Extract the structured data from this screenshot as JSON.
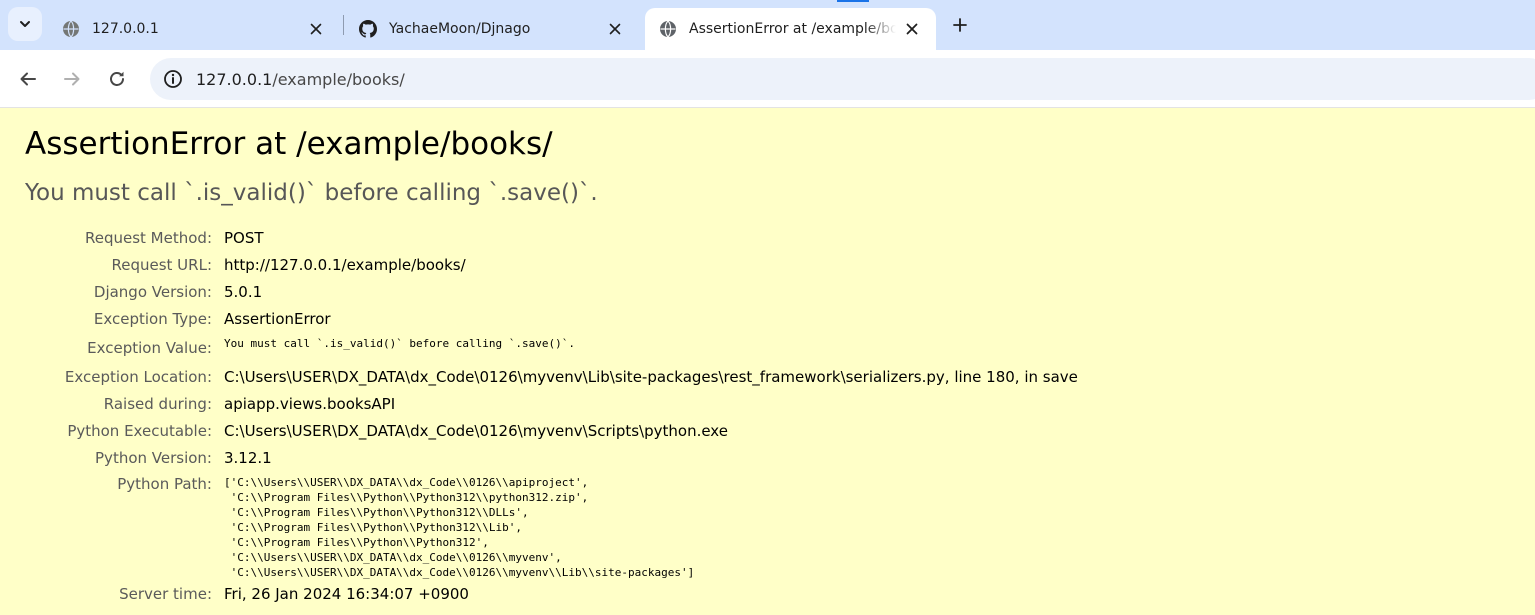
{
  "browser": {
    "tabs": [
      {
        "title": "127.0.0.1",
        "favicon": "globe-icon",
        "active": false
      },
      {
        "title": "YachaeMoon/Djnago",
        "favicon": "github-icon",
        "active": false
      },
      {
        "title": "AssertionError at /example/books/",
        "favicon": "globe-icon",
        "active": true
      }
    ],
    "url": {
      "host": "127.0.0.1",
      "path": "/example/books/"
    },
    "colors": {
      "tabstrip": "#d3e3fd",
      "omnibox": "#edf2fa",
      "accent": "#1a73e8"
    }
  },
  "error": {
    "title": "AssertionError at /example/books/",
    "value": "You must call `.is_valid()` before calling `.save()`.",
    "background": "#ffffc8",
    "meta": [
      {
        "label": "Request Method:",
        "value": "POST"
      },
      {
        "label": "Request URL:",
        "value": "http://127.0.0.1/example/books/"
      },
      {
        "label": "Django Version:",
        "value": "5.0.1"
      },
      {
        "label": "Exception Type:",
        "value": "AssertionError"
      },
      {
        "label": "Exception Value:",
        "value": "You must call `.is_valid()` before calling `.save()`."
      },
      {
        "label": "Exception Location:",
        "value": "C:\\Users\\USER\\DX_DATA\\dx_Code\\0126\\myvenv\\Lib\\site-packages\\rest_framework\\serializers.py, line 180, in save"
      },
      {
        "label": "Raised during:",
        "value": "apiapp.views.booksAPI"
      },
      {
        "label": "Python Executable:",
        "value": "C:\\Users\\USER\\DX_DATA\\dx_Code\\0126\\myvenv\\Scripts\\python.exe"
      },
      {
        "label": "Python Version:",
        "value": "3.12.1"
      },
      {
        "label": "Python Path:",
        "value": "['C:\\\\Users\\\\USER\\\\DX_DATA\\\\dx_Code\\\\0126\\\\apiproject',\n 'C:\\\\Program Files\\\\Python\\\\Python312\\\\python312.zip',\n 'C:\\\\Program Files\\\\Python\\\\Python312\\\\DLLs',\n 'C:\\\\Program Files\\\\Python\\\\Python312\\\\Lib',\n 'C:\\\\Program Files\\\\Python\\\\Python312',\n 'C:\\\\Users\\\\USER\\\\DX_DATA\\\\dx_Code\\\\0126\\\\myvenv',\n 'C:\\\\Users\\\\USER\\\\DX_DATA\\\\dx_Code\\\\0126\\\\myvenv\\\\Lib\\\\site-packages']"
      },
      {
        "label": "Server time:",
        "value": "Fri, 26 Jan 2024 16:34:07 +0900"
      }
    ]
  }
}
